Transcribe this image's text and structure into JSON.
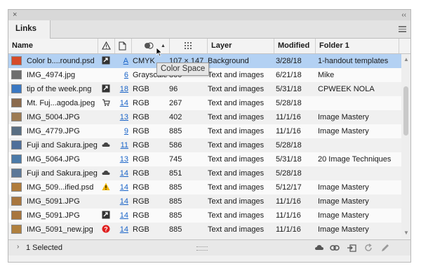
{
  "panel": {
    "tab_label": "Links",
    "close_glyph": "×",
    "collapse_glyph": "‹‹"
  },
  "columns": {
    "name": "Name",
    "status_icon": "warning-triangle-icon",
    "page_icon": "page-icon",
    "color_space_icon": "color-space-icon",
    "ppi_icon": "ppi-grid-icon",
    "layer": "Layer",
    "modified": "Modified",
    "folder": "Folder 1"
  },
  "tooltip": "Color Space",
  "rows": [
    {
      "name": "Color b....round.psd",
      "status": "link-modified-icon",
      "page": "A",
      "colorspace": "CMYK",
      "ppi": "107 × 147",
      "layer": "Background",
      "modified": "3/28/18",
      "folder": "1-handout templates",
      "thumb": "#d64b2a",
      "selected": true
    },
    {
      "name": "IMG_4974.jpg",
      "status": "",
      "page": "6",
      "colorspace": "Grayscale",
      "ppi": "800",
      "layer": "Text and images",
      "modified": "6/21/18",
      "folder": "Mike",
      "thumb": "#6e6e6e"
    },
    {
      "name": "tip of the week.png",
      "status": "link-modified-icon",
      "page": "18",
      "colorspace": "RGB",
      "ppi": "96",
      "layer": "Text and images",
      "modified": "5/31/18",
      "folder": "CPWEEK NOLA",
      "thumb": "#3a78c2"
    },
    {
      "name": "Mt. Fuj...agoda.jpeg",
      "status": "cart-icon",
      "page": "14",
      "colorspace": "RGB",
      "ppi": "267",
      "layer": "Text and images",
      "modified": "5/28/18",
      "folder": "",
      "thumb": "#8a6a4c"
    },
    {
      "name": "IMG_5004.JPG",
      "status": "",
      "page": "13",
      "colorspace": "RGB",
      "ppi": "402",
      "layer": "Text and images",
      "modified": "11/1/16",
      "folder": "Image Mastery",
      "thumb": "#9c7a52"
    },
    {
      "name": "IMG_4779.JPG",
      "status": "",
      "page": "9",
      "colorspace": "RGB",
      "ppi": "885",
      "layer": "Text and images",
      "modified": "11/1/16",
      "folder": "Image Mastery",
      "thumb": "#5a6f83"
    },
    {
      "name": "Fuji and Sakura.jpeg",
      "status": "cloud-icon",
      "page": "11",
      "colorspace": "RGB",
      "ppi": "586",
      "layer": "Text and images",
      "modified": "5/28/18",
      "folder": "",
      "thumb": "#4f6f9a"
    },
    {
      "name": "IMG_5064.JPG",
      "status": "",
      "page": "13",
      "colorspace": "RGB",
      "ppi": "745",
      "layer": "Text and images",
      "modified": "5/31/18",
      "folder": "20 Image Techniques",
      "thumb": "#4b7aa8"
    },
    {
      "name": "Fuji and Sakura.jpeg",
      "status": "cloud-icon",
      "page": "14",
      "colorspace": "RGB",
      "ppi": "851",
      "layer": "Text and images",
      "modified": "5/28/18",
      "folder": "",
      "thumb": "#5c7898"
    },
    {
      "name": "IMG_509...ified.psd",
      "status": "warning-icon",
      "page": "14",
      "colorspace": "RGB",
      "ppi": "885",
      "layer": "Text and images",
      "modified": "5/12/17",
      "folder": "Image Mastery",
      "thumb": "#b07c3c"
    },
    {
      "name": "IMG_5091.JPG",
      "status": "",
      "page": "14",
      "colorspace": "RGB",
      "ppi": "885",
      "layer": "Text and images",
      "modified": "11/1/16",
      "folder": "Image Mastery",
      "thumb": "#a8763e"
    },
    {
      "name": "IMG_5091.JPG",
      "status": "link-modified-icon",
      "page": "14",
      "colorspace": "RGB",
      "ppi": "885",
      "layer": "Text and images",
      "modified": "11/1/16",
      "folder": "Image Mastery",
      "thumb": "#a8763e"
    },
    {
      "name": "IMG_5091_new.jpg",
      "status": "missing-icon",
      "page": "14",
      "colorspace": "RGB",
      "ppi": "885",
      "layer": "Text and images",
      "modified": "11/1/16",
      "folder": "Image Mastery",
      "thumb": "#b0803e"
    }
  ],
  "footer": {
    "selected_label": "1 Selected",
    "chevron": "›",
    "icons": [
      "cloud-link-icon",
      "relink-icon",
      "goto-link-icon",
      "update-link-icon",
      "edit-original-icon"
    ]
  },
  "colors": {
    "selection": "#b3d1f3",
    "link_blue": "#1a64c8",
    "warning": "#f2b600",
    "missing": "#e02020"
  }
}
